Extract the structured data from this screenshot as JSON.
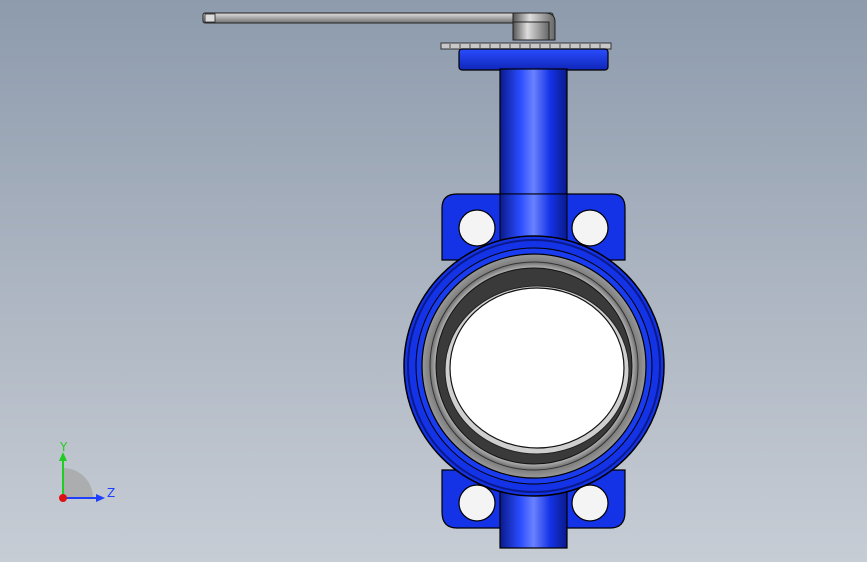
{
  "viewport": {
    "background_top": "#8d9bad",
    "background_bottom": "#c7cdd5"
  },
  "model": {
    "body_color": "#1432e6",
    "body_dark": "#0a1a8a",
    "liner_color": "#8a8a8a",
    "handle_color": "#b8b8b8"
  },
  "triad": {
    "y_label": "Y",
    "z_label": "Z",
    "y_color": "#22cc22",
    "z_color": "#1f3fff",
    "x_color": "#dd1111"
  }
}
